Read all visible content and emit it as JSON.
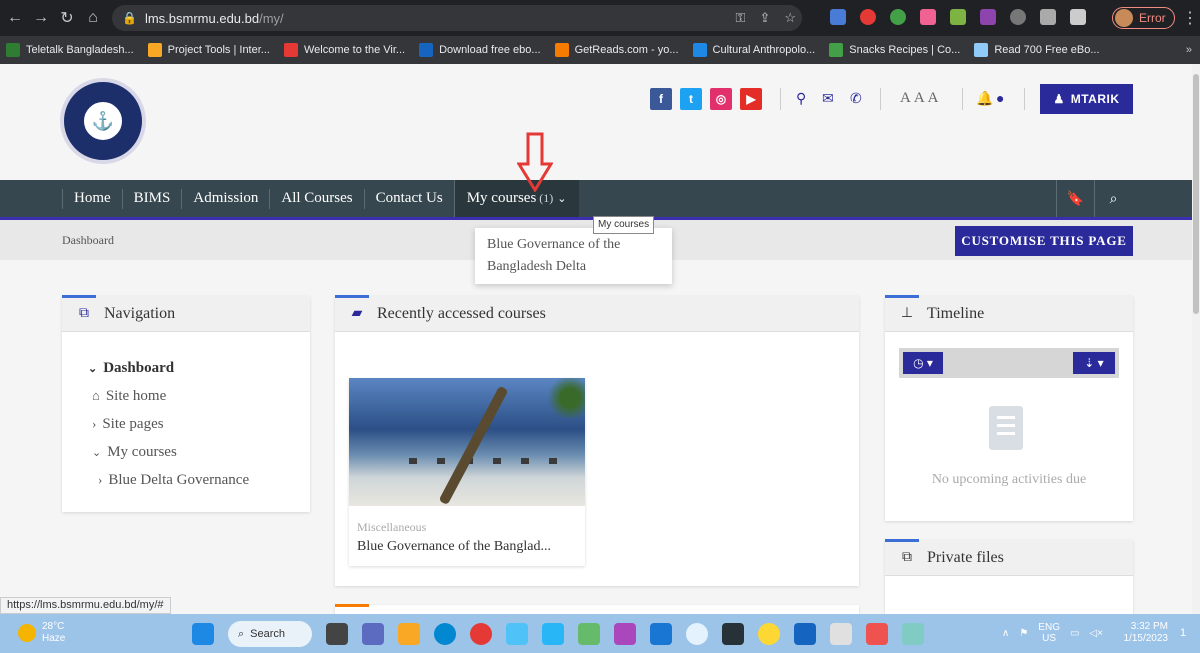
{
  "browser": {
    "url_host": "lms.bsmrmu.edu.bd",
    "url_path": "/my/",
    "profile_label": "Error",
    "bookmarks": [
      {
        "label": "Teletalk Bangladesh...",
        "color": "#2e7d32"
      },
      {
        "label": "Project Tools | Inter...",
        "color": "#f9a825"
      },
      {
        "label": "Welcome to the Vir...",
        "color": "#e53935"
      },
      {
        "label": "Download free ebo...",
        "color": "#1565c0"
      },
      {
        "label": "GetReads.com - yo...",
        "color": "#f57c00"
      },
      {
        "label": "Cultural Anthropolo...",
        "color": "#1e88e5"
      },
      {
        "label": "Snacks Recipes | Co...",
        "color": "#43a047"
      },
      {
        "label": "Read 700 Free eBo...",
        "color": "#90caf9"
      }
    ],
    "bookmarks_more": "»",
    "status_url": "https://lms.bsmrmu.edu.bd/my/#"
  },
  "header": {
    "aaa": "AAA",
    "user_label": "MTARIK"
  },
  "nav": {
    "items": [
      "Home",
      "BIMS",
      "Admission",
      "All Courses",
      "Contact Us"
    ],
    "my_courses": "My courses",
    "my_courses_count": "(1)",
    "tooltip": "My courses",
    "dropdown_line1": "Blue Governance of the",
    "dropdown_line2": "Bangladesh Delta"
  },
  "breadcrumb": {
    "dashboard": "Dashboard",
    "customise": "CUSTOMISE THIS PAGE"
  },
  "navigation_block": {
    "title": "Navigation",
    "dashboard": "Dashboard",
    "site_home": "Site home",
    "site_pages": "Site pages",
    "my_courses": "My courses",
    "course": "Blue Delta Governance"
  },
  "recent_block": {
    "title": "Recently accessed courses",
    "course_category": "Miscellaneous",
    "course_name": "Blue Governance of the Banglad..."
  },
  "timeline_block": {
    "title": "Timeline",
    "empty_text": "No upcoming activities due"
  },
  "files_block": {
    "title": "Private files"
  },
  "taskbar": {
    "temp": "28°C",
    "weather": "Haze",
    "search": "Search",
    "lang1": "ENG",
    "lang2": "US",
    "time": "3:32 PM",
    "date": "1/15/2023",
    "notif": "1"
  },
  "colors": {
    "brand": "#2a2a9a",
    "navbar": "#37474f",
    "arrow": "#e53935"
  }
}
